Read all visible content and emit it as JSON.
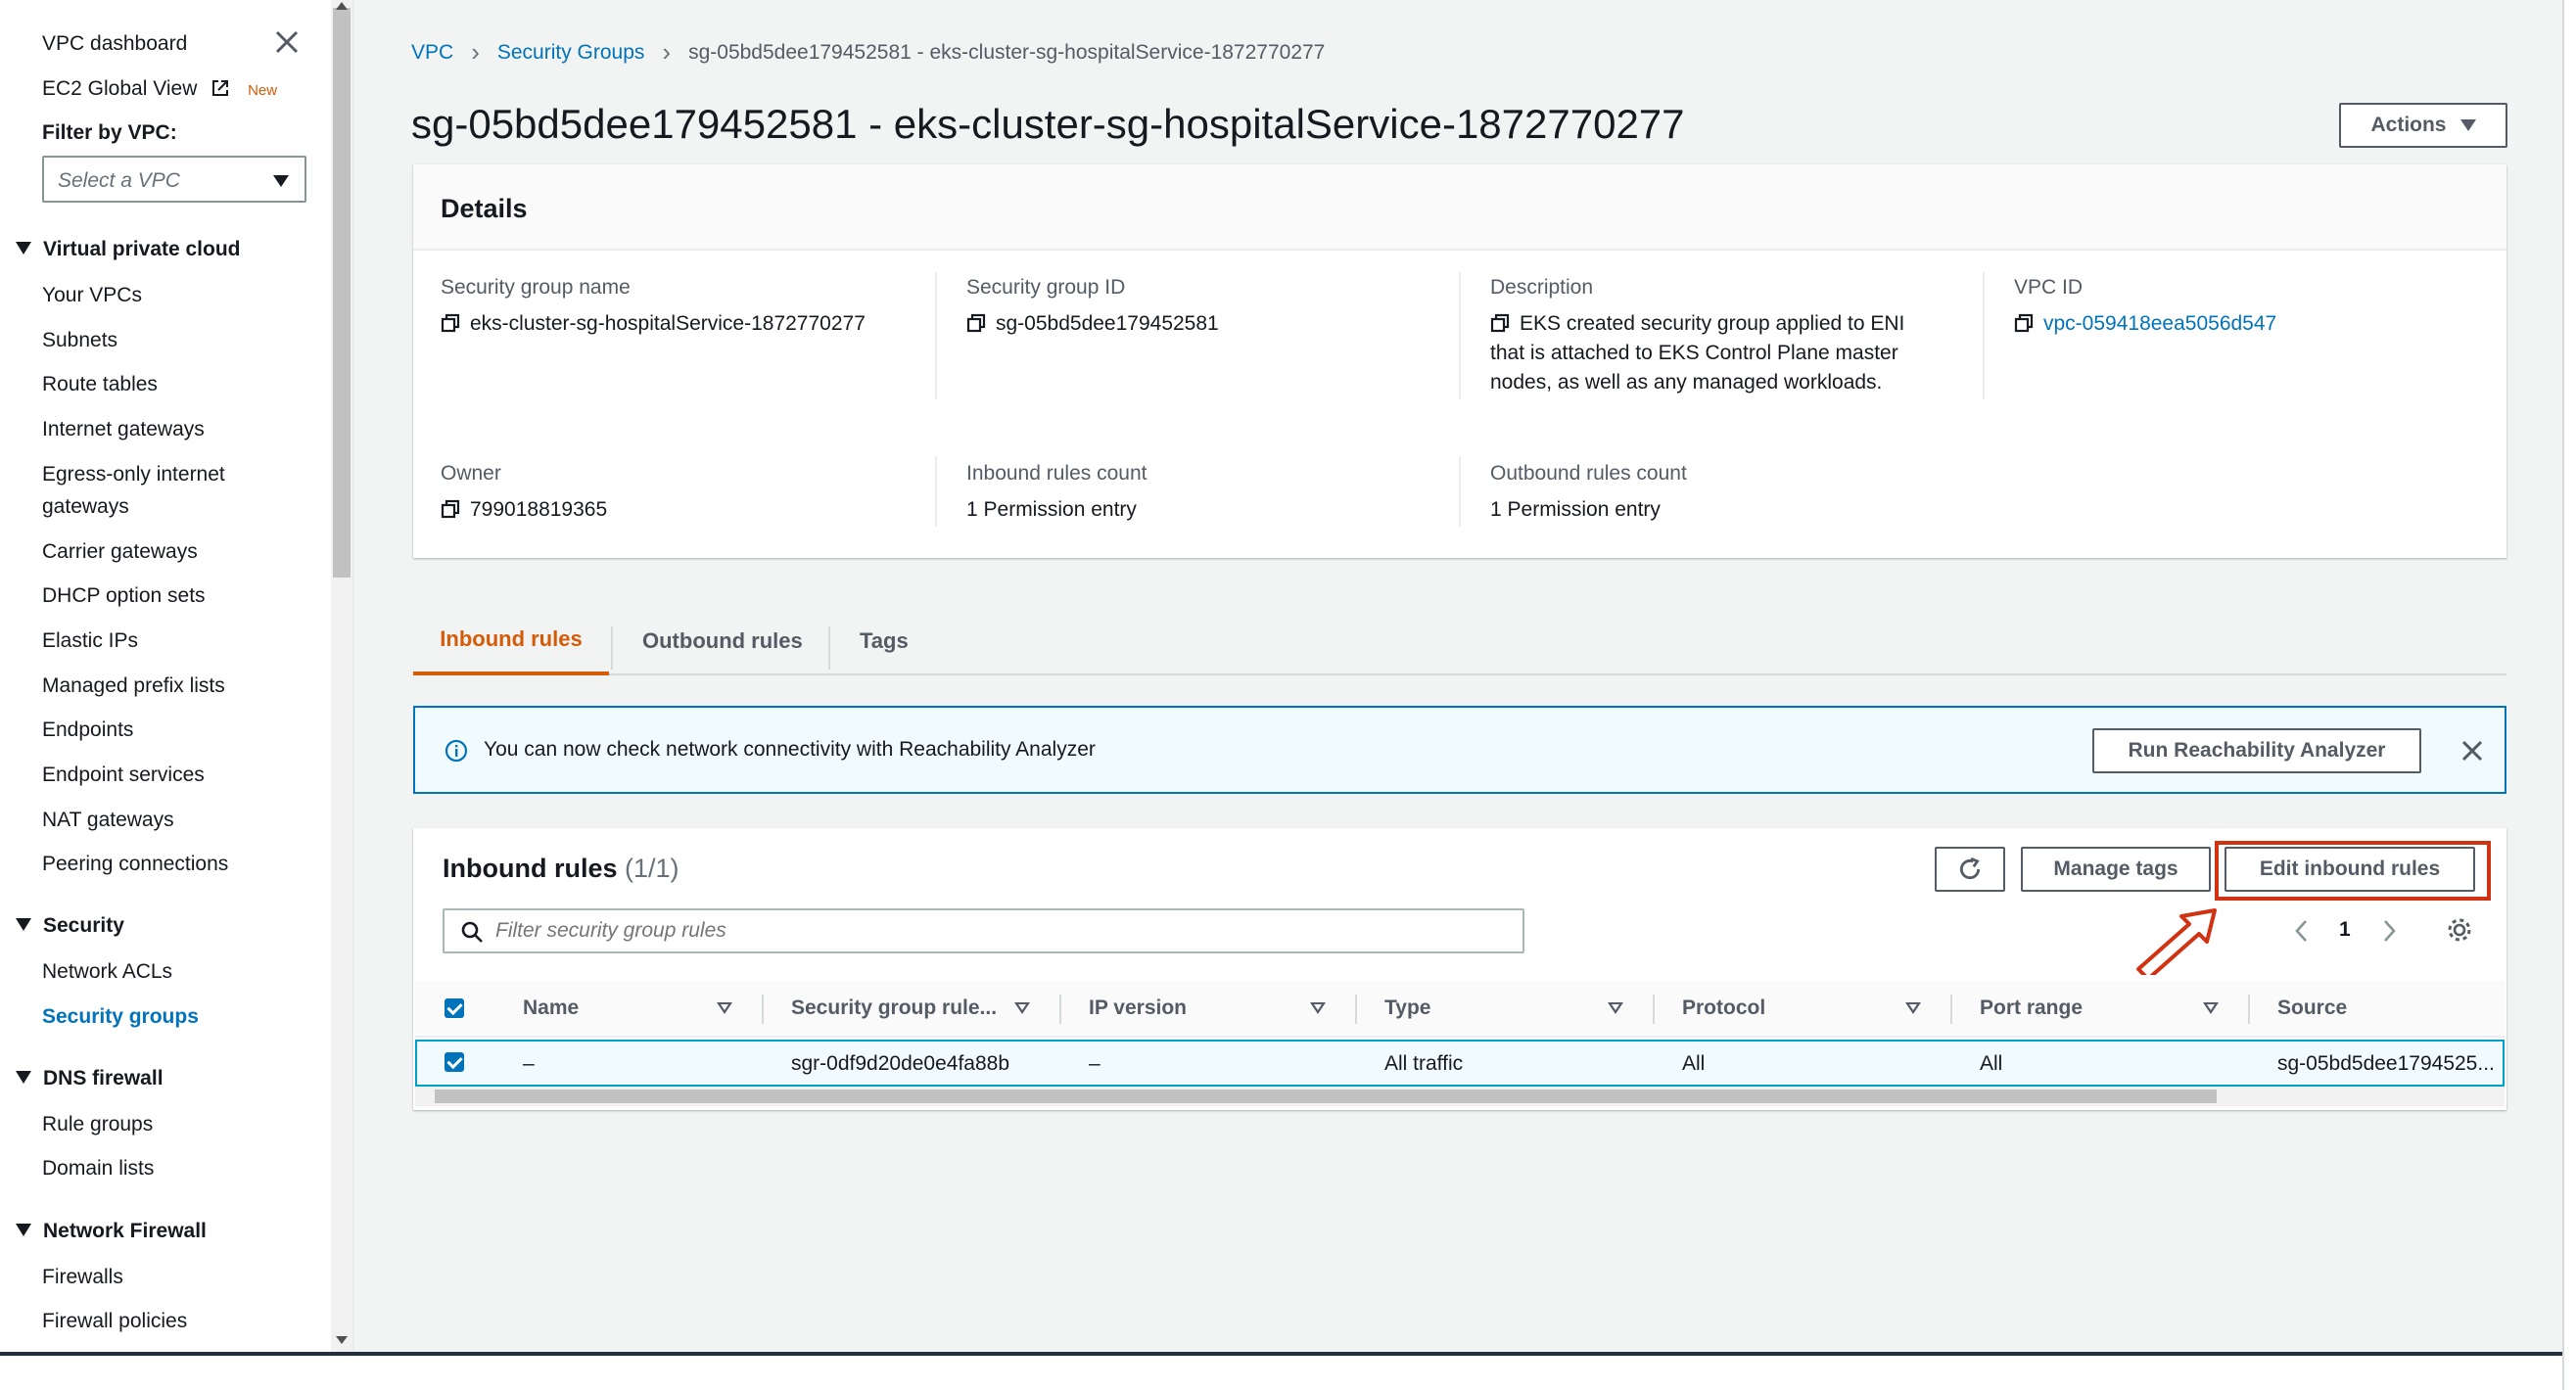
{
  "sidebar": {
    "top_links": {
      "vpc_dashboard": "VPC dashboard",
      "ec2_global_view": "EC2 Global View",
      "new_badge": "New"
    },
    "filter_label": "Filter by VPC:",
    "filter_placeholder": "Select a VPC",
    "sections": {
      "vpc": {
        "title": "Virtual private cloud",
        "items": [
          "Your VPCs",
          "Subnets",
          "Route tables",
          "Internet gateways",
          "Egress-only internet",
          "gateways",
          "Carrier gateways",
          "DHCP option sets",
          "Elastic IPs",
          "Managed prefix lists",
          "Endpoints",
          "Endpoint services",
          "NAT gateways",
          "Peering connections"
        ]
      },
      "security": {
        "title": "Security",
        "items": [
          "Network ACLs",
          "Security groups"
        ]
      },
      "dns_firewall": {
        "title": "DNS firewall",
        "items": [
          "Rule groups",
          "Domain lists"
        ]
      },
      "network_firewall": {
        "title": "Network Firewall",
        "items": [
          "Firewalls",
          "Firewall policies"
        ]
      }
    }
  },
  "breadcrumb": {
    "root": "VPC",
    "parent": "Security Groups",
    "current": "sg-05bd5dee179452581 - eks-cluster-sg-hospitalService-1872770277"
  },
  "page_title": "sg-05bd5dee179452581 - eks-cluster-sg-hospitalService-1872770277",
  "actions_label": "Actions",
  "details": {
    "header": "Details",
    "sg_name_label": "Security group name",
    "sg_name_value": "eks-cluster-sg-hospitalService-1872770277",
    "sg_id_label": "Security group ID",
    "sg_id_value": "sg-05bd5dee179452581",
    "description_label": "Description",
    "description_lines": [
      "EKS created security group applied to ENI",
      "that is attached to EKS Control Plane master",
      "nodes, as well as any managed workloads."
    ],
    "vpc_id_label": "VPC ID",
    "vpc_id_value": "vpc-059418eea5056d547",
    "owner_label": "Owner",
    "owner_value": "799018819365",
    "inbound_count_label": "Inbound rules count",
    "inbound_count_value": "1 Permission entry",
    "outbound_count_label": "Outbound rules count",
    "outbound_count_value": "1 Permission entry"
  },
  "tabs": [
    "Inbound rules",
    "Outbound rules",
    "Tags"
  ],
  "banner": {
    "text": "You can now check network connectivity with Reachability Analyzer",
    "button": "Run Reachability Analyzer"
  },
  "inbound": {
    "title": "Inbound rules",
    "count": "(1/1)",
    "manage_tags": "Manage tags",
    "edit_inbound": "Edit inbound rules",
    "filter_placeholder": "Filter security group rules",
    "page_number": "1",
    "columns": [
      "Name",
      "Security group rule...",
      "IP version",
      "Type",
      "Protocol",
      "Port range",
      "Source"
    ],
    "rows": [
      {
        "name": "–",
        "rule_id": "sgr-0df9d20de0e4fa88b",
        "ip_version": "–",
        "type": "All traffic",
        "protocol": "All",
        "port_range": "All",
        "source": "sg-05bd5dee1794525..."
      }
    ]
  },
  "colors": {
    "link": "#0073bb",
    "active_tab": "#d45b07",
    "highlight": "#d13212",
    "background": "#f2f3f3"
  }
}
